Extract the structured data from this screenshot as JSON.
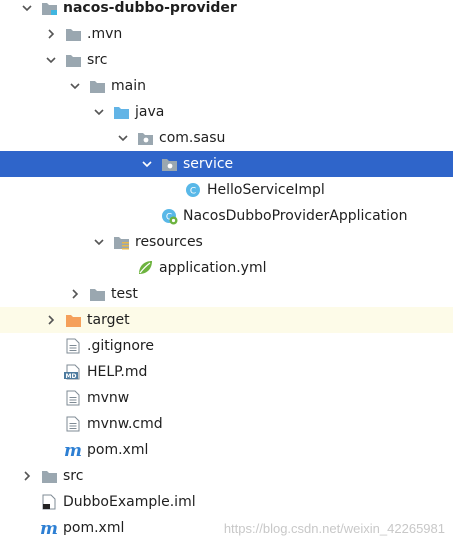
{
  "tree": [
    {
      "label": "nacos-dubbo-provider",
      "depth": 0,
      "arrow": "down",
      "icon": "module-folder-icon",
      "bold": true
    },
    {
      "label": ".mvn",
      "depth": 1,
      "arrow": "right",
      "icon": "folder-icon"
    },
    {
      "label": "src",
      "depth": 1,
      "arrow": "down",
      "icon": "folder-icon"
    },
    {
      "label": "main",
      "depth": 2,
      "arrow": "down",
      "icon": "folder-icon"
    },
    {
      "label": "java",
      "depth": 3,
      "arrow": "down",
      "icon": "source-folder-icon"
    },
    {
      "label": "com.sasu",
      "depth": 4,
      "arrow": "down",
      "icon": "package-icon"
    },
    {
      "label": "service",
      "depth": 5,
      "arrow": "down",
      "icon": "package-icon",
      "selected": true
    },
    {
      "label": "HelloServiceImpl",
      "depth": 6,
      "arrow": "none",
      "icon": "java-class-icon"
    },
    {
      "label": "NacosDubboProviderApplication",
      "depth": 5,
      "arrow": "none",
      "icon": "spring-boot-class-icon"
    },
    {
      "label": "resources",
      "depth": 3,
      "arrow": "down",
      "icon": "resources-folder-icon"
    },
    {
      "label": "application.yml",
      "depth": 4,
      "arrow": "none",
      "icon": "spring-yml-icon"
    },
    {
      "label": "test",
      "depth": 2,
      "arrow": "right",
      "icon": "folder-icon"
    },
    {
      "label": "target",
      "depth": 1,
      "arrow": "right",
      "icon": "excluded-folder-icon",
      "highlighted": true
    },
    {
      "label": ".gitignore",
      "depth": 1,
      "arrow": "none",
      "icon": "text-file-icon"
    },
    {
      "label": "HELP.md",
      "depth": 1,
      "arrow": "none",
      "icon": "markdown-file-icon"
    },
    {
      "label": "mvnw",
      "depth": 1,
      "arrow": "none",
      "icon": "text-file-icon"
    },
    {
      "label": "mvnw.cmd",
      "depth": 1,
      "arrow": "none",
      "icon": "text-file-icon"
    },
    {
      "label": "pom.xml",
      "depth": 1,
      "arrow": "none",
      "icon": "maven-pom-icon"
    },
    {
      "label": "src",
      "depth": 0,
      "arrow": "right",
      "icon": "folder-icon"
    },
    {
      "label": "DubboExample.iml",
      "depth": 0,
      "arrow": "none",
      "icon": "iml-file-icon"
    },
    {
      "label": "pom.xml",
      "depth": 0,
      "arrow": "none",
      "icon": "maven-pom-icon"
    }
  ],
  "watermark": "https://blog.csdn.net/weixin_42265981",
  "colors": {
    "selected_bg": "#2f65ca",
    "highlight_bg": "#fdfbe8",
    "folder": "#9aa7b0",
    "source_folder": "#62b4e6",
    "excluded_folder": "#f5a05b"
  }
}
